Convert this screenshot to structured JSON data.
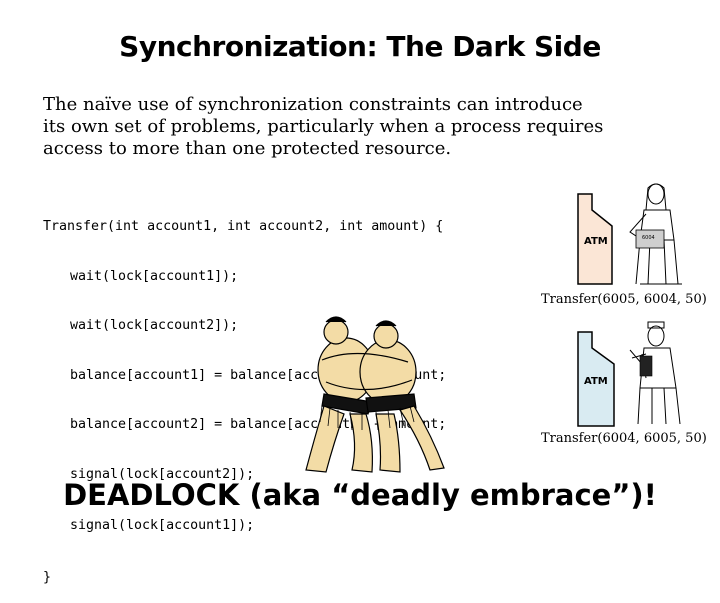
{
  "slide": {
    "title": "Synchronization: The Dark Side",
    "intro_lines": [
      "The naïve use of synchronization constraints can introduce",
      "its own set of problems, particularly when a process requires",
      "access to more than one protected resource."
    ],
    "code_lines": [
      "Transfer(int account1, int account2, int amount) {",
      "wait(lock[account1]);",
      "wait(lock[account2]);",
      "balance[account1] = balance[account1] - amount;",
      "balance[account2] = balance[account2] + amount;",
      "signal(lock[account2]);",
      "signal(lock[account1]);",
      "}"
    ],
    "atm_top": {
      "label": "ATM",
      "card_text": "6004",
      "caption": "Transfer(6005, 6004, 50)"
    },
    "atm_bottom": {
      "label": "ATM",
      "caption": "Transfer(6004, 6005, 50)"
    },
    "footer": "DEADLOCK (aka “deadly embrace”)!"
  },
  "colors": {
    "atm_top_fill": "#fbe6d6",
    "atm_bottom_fill": "#d9ebf2",
    "sumo_skin": "#f3dca6",
    "ink": "#000000"
  }
}
